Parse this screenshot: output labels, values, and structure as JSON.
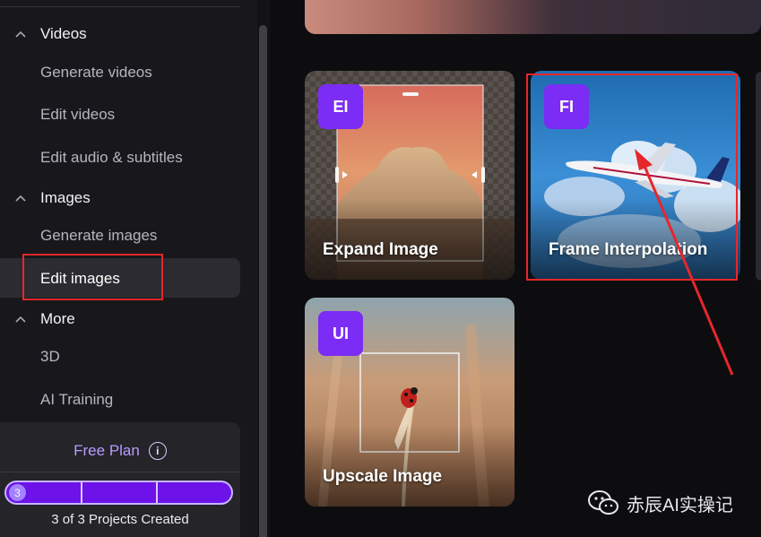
{
  "sidebar": {
    "sections": [
      {
        "label": "Videos",
        "items": [
          "Generate videos",
          "Edit videos",
          "Edit audio & subtitles"
        ]
      },
      {
        "label": "Images",
        "items": [
          "Generate images",
          "Edit images"
        ]
      },
      {
        "label": "More",
        "items": [
          "3D",
          "AI Training"
        ]
      }
    ],
    "active_item": "Edit images",
    "plan": {
      "title": "Free Plan",
      "info_icon": "info-icon",
      "progress_count": "3",
      "progress_fraction": 1.0,
      "caption": "3 of 3 Projects Created"
    }
  },
  "cards": [
    {
      "badge": "EI",
      "title": "Expand Image"
    },
    {
      "badge": "FI",
      "title": "Frame Interpolation"
    },
    {
      "badge": "UI",
      "title": "Upscale Image"
    }
  ],
  "annotations": {
    "highlight_color": "#e6272a",
    "highlighted": [
      "Edit images",
      "Frame Interpolation"
    ]
  },
  "watermark": {
    "icon": "wechat-icon",
    "text": "赤辰AI实操记"
  },
  "colors": {
    "accent": "#7b2cf5",
    "plan_title": "#b79cff",
    "sidebar_bg": "#18181c"
  }
}
